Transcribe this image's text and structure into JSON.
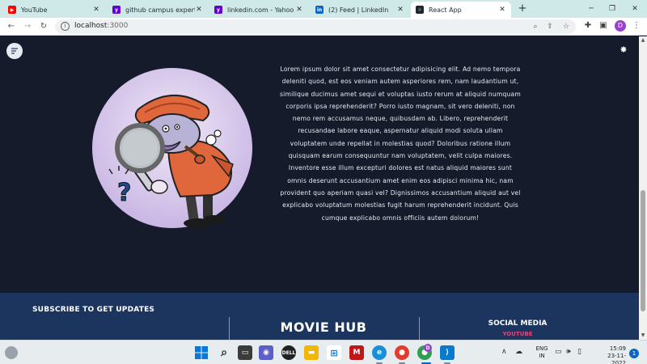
{
  "browser": {
    "tabs": [
      {
        "title": "YouTube",
        "icon": "youtube-icon",
        "color": "#ff0000",
        "active": false
      },
      {
        "title": "github campus expert - Y",
        "icon": "yahoo-icon",
        "color": "#6001d2",
        "active": false
      },
      {
        "title": "linkedin.com - Yahoo Indi",
        "icon": "yahoo-icon",
        "color": "#6001d2",
        "active": false
      },
      {
        "title": "(2) Feed | LinkedIn",
        "icon": "linkedin-icon",
        "color": "#0a66c2",
        "active": false
      },
      {
        "title": "React App",
        "icon": "react-icon",
        "color": "#61dafb",
        "active": true
      }
    ],
    "new_tab_glyph": "+",
    "url_host": "localhost",
    "url_port": ":3000",
    "profile_initial": "D",
    "profile_color": "#9c3fd1"
  },
  "page": {
    "body_text": "Lorem ipsum dolor sit amet consectetur adipisicing elit. Ad nemo tempora deleniti quod, est eos veniam autem asperiores rem, nam laudantium ut, similique ducimus amet sequi et voluptas iusto rerum at aliquid numquam corporis ipsa reprehenderit? Porro iusto magnam, sit vero deleniti, non nemo rem accusamus neque, quibusdam ab. Libero, reprehenderit recusandae labore eaque, aspernatur aliquid modi soluta ullam voluptatem unde repellat in molestias quod? Doloribus ratione illum quisquam earum consequuntur nam voluptatem, velit culpa maiores. Inventore esse illum excepturi dolores est natus aliquid maiores sunt omnis deserunt accusantium amet enim eos adipisci minima hic, nam provident quo aperiam quasi vel? Dignissimos accusantium aliquid aut vel explicabo voluptatum molestias fugit harum reprehenderit incidunt. Quis cumque explicabo omnis officiis autem dolorum!",
    "background_color": "#151b2a"
  },
  "footer": {
    "subscribe_title": "SUBSCRIBE TO GET UPDATES",
    "brand": "MOVIE HUB",
    "social_title": "SOCIAL MEDIA",
    "social_link": "YOUTUBE",
    "background_color": "#1c355e",
    "link_color": "#e0457b"
  },
  "taskbar": {
    "lang_line1": "ENG",
    "lang_line2": "IN",
    "time": "15:09",
    "date": "23-11-2022",
    "notification_count": "1",
    "chrome_badge": "D"
  }
}
